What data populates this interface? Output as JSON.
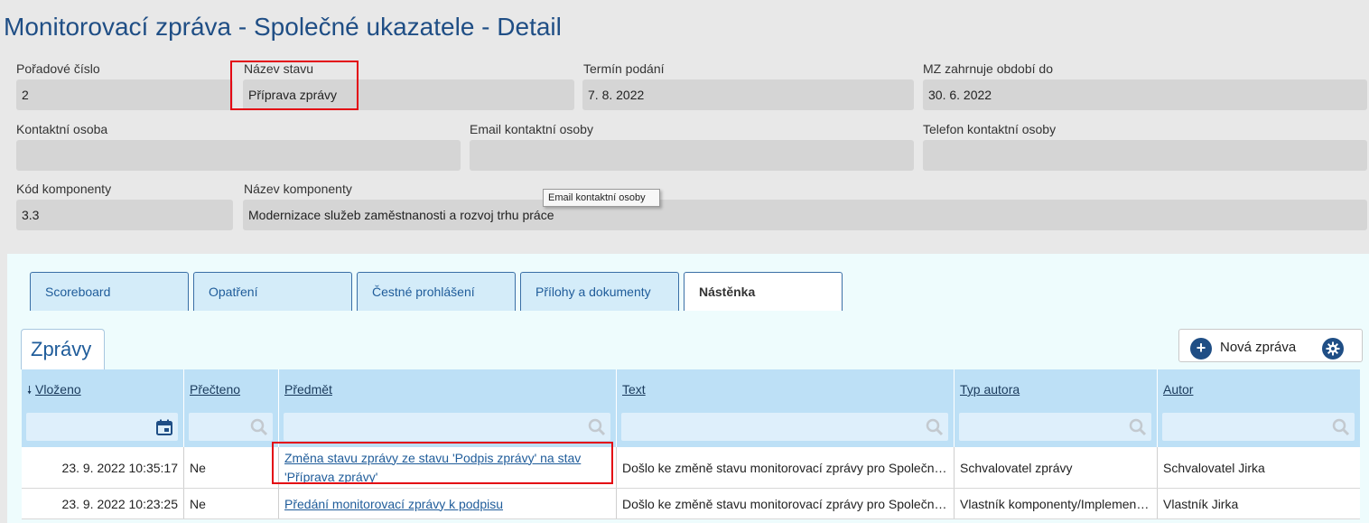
{
  "page": {
    "title": "Monitorovací zpráva - Společné ukazatele - Detail"
  },
  "fields": {
    "poradove_cislo": {
      "label": "Pořadové číslo",
      "value": "2"
    },
    "nazev_stavu": {
      "label": "Název stavu",
      "value": "Příprava zprávy"
    },
    "termin_podani": {
      "label": "Termín podání",
      "value": "7. 8. 2022"
    },
    "obdobi_do": {
      "label": "MZ zahrnuje období do",
      "value": "30. 6. 2022"
    },
    "kontaktni_osoba": {
      "label": "Kontaktní osoba",
      "value": ""
    },
    "email": {
      "label": "Email kontaktní osoby",
      "value": ""
    },
    "telefon": {
      "label": "Telefon kontaktní osoby",
      "value": ""
    },
    "kod_komponenty": {
      "label": "Kód komponenty",
      "value": "3.3"
    },
    "nazev_komponenty": {
      "label": "Název komponenty",
      "value": "Modernizace služeb zaměstnanosti a rozvoj trhu práce"
    }
  },
  "tooltip": {
    "text": "Email kontaktní osoby"
  },
  "tabs": [
    {
      "label": "Scoreboard"
    },
    {
      "label": "Opatření"
    },
    {
      "label": "Čestné prohlášení"
    },
    {
      "label": "Přílohy a dokumenty"
    },
    {
      "label": "Nástěnka",
      "active": true
    }
  ],
  "messages": {
    "title": "Zprávy",
    "new_button": "Nová zpráva",
    "columns": {
      "vlozeno": "Vloženo",
      "precteno": "Přečteno",
      "predmet": "Předmět",
      "text": "Text",
      "typ_autora": "Typ autora",
      "autor": "Autor"
    },
    "sort_indicator": "🠗",
    "rows": [
      {
        "vlozeno": "23. 9. 2022 10:35:17",
        "precteno": "Ne",
        "predmet": "Změna stavu zprávy ze stavu 'Podpis zprávy' na stav 'Příprava zprávy'",
        "text": "Došlo ke změně stavu monitorovací zprávy pro Společné ukazatele",
        "typ_autora": "Schvalovatel zprávy",
        "autor": "Schvalovatel Jirka"
      },
      {
        "vlozeno": "23. 9. 2022 10:23:25",
        "precteno": "Ne",
        "predmet": "Předání monitorovací zprávy k podpisu",
        "text": "Došlo ke změně stavu monitorovací zprávy pro Společné ukazatele",
        "typ_autora": "Vlastník komponenty/Implementátor",
        "autor": "Vlastník Jirka"
      }
    ]
  },
  "colors": {
    "accent": "#1f4e85",
    "highlight": "#e30613",
    "header_bg": "#bde0f6",
    "content_bg": "#eefcfd"
  }
}
